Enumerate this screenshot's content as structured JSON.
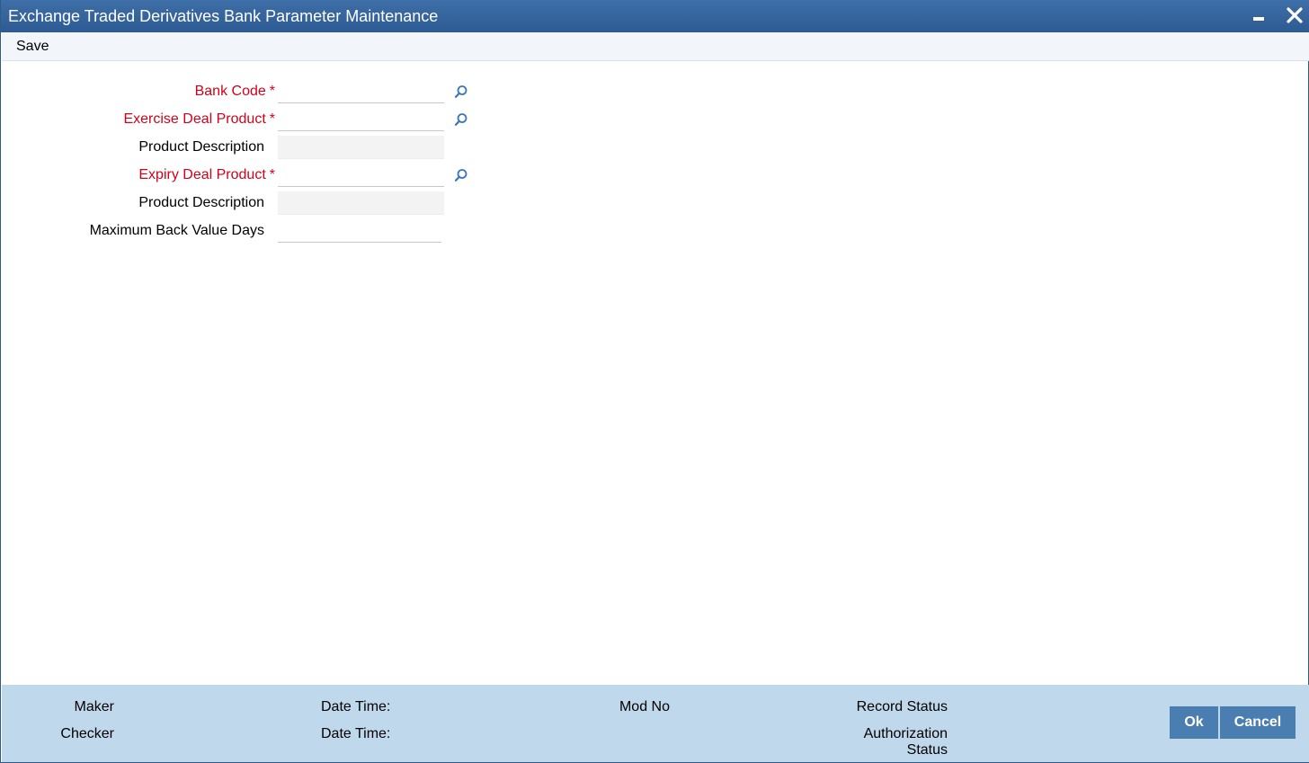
{
  "window": {
    "title": "Exchange Traded Derivatives Bank Parameter Maintenance",
    "controls": [
      "minimize-icon",
      "close-icon"
    ]
  },
  "toolbar": {
    "save_label": "Save"
  },
  "form": {
    "bank_code": {
      "label": "Bank Code",
      "required_mark": "*",
      "value": ""
    },
    "exercise_deal_product": {
      "label": "Exercise Deal Product",
      "required_mark": "*",
      "value": ""
    },
    "exercise_product_description": {
      "label": "Product Description",
      "value": ""
    },
    "expiry_deal_product": {
      "label": "Expiry Deal Product",
      "required_mark": "*",
      "value": ""
    },
    "expiry_product_description": {
      "label": "Product Description",
      "value": ""
    },
    "max_back_value_days": {
      "label": "Maximum Back Value Days",
      "value": ""
    }
  },
  "footer": {
    "maker_label": "Maker",
    "checker_label": "Checker",
    "maker_datetime_label": "Date Time:",
    "checker_datetime_label": "Date Time:",
    "mod_no_label": "Mod No",
    "record_status_label": "Record Status",
    "auth_status_label_line1": "Authorization",
    "auth_status_label_line2": "Status",
    "ok_label": "Ok",
    "cancel_label": "Cancel"
  },
  "colors": {
    "titlebar": "#2d5a92",
    "required_label": "#d0021b",
    "footer_bg": "#c0d8ec",
    "button_bg": "#4a7eb0"
  }
}
